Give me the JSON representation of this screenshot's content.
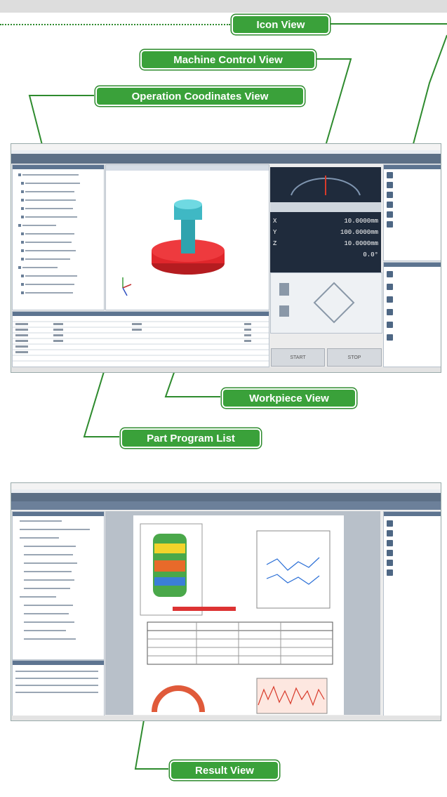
{
  "callouts": {
    "icon_view": "Icon View",
    "machine_control_view": "Machine Control View",
    "operation_coordinates_view": "Operation Coodinates View",
    "workpiece_view": "Workpiece View",
    "part_program_list": "Part Program List",
    "result_view": "Result View"
  },
  "machine_control": {
    "coordinates": [
      {
        "axis": "X",
        "value": "10.0000mm"
      },
      {
        "axis": "Y",
        "value": "100.0000mm"
      },
      {
        "axis": "Z",
        "value": "10.0000mm"
      },
      {
        "axis": "",
        "value": "0.0°"
      }
    ],
    "start_label": "START",
    "stop_label": "STOP"
  },
  "colors": {
    "callout_green": "#3aa13a",
    "leader_green": "#2e8b2e",
    "toolbar_blue": "#5c6f86",
    "workpiece_red": "#e0262b",
    "workpiece_cyan": "#3fb8c4"
  }
}
